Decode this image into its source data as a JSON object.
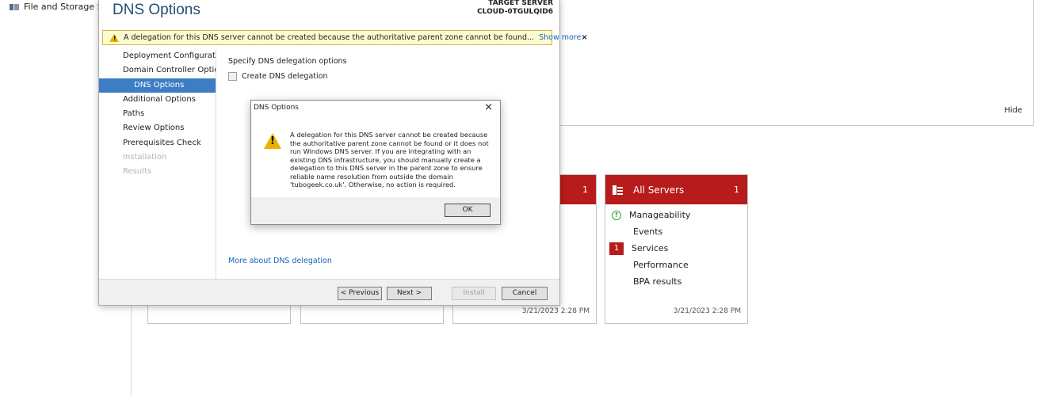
{
  "background": {
    "nav_item": "File and Storage Ser",
    "hide_label": "Hide",
    "tile_badge_count": "1",
    "tile3_timestamp": "3/21/2023 2:28 PM",
    "all_servers": {
      "title": "All Servers",
      "count": "1",
      "rows": [
        {
          "label": "Manageability",
          "badge": "",
          "icon": "up-arrow-circle-icon"
        },
        {
          "label": "Events",
          "badge": ""
        },
        {
          "label": "Services",
          "badge": "1"
        },
        {
          "label": "Performance",
          "badge": ""
        },
        {
          "label": "BPA results",
          "badge": ""
        }
      ],
      "timestamp": "3/21/2023 2:28 PM"
    }
  },
  "wizard": {
    "title": "DNS Options",
    "target_label": "TARGET SERVER",
    "target_name": "CLOUD-0TGULQID6",
    "banner_text": "A delegation for this DNS server cannot be created because the authoritative parent zone cannot be found...",
    "show_more": "Show more",
    "banner_close": "×",
    "nav": [
      "Deployment Configuration",
      "Domain Controller Options",
      "DNS Options",
      "Additional Options",
      "Paths",
      "Review Options",
      "Prerequisites Check",
      "Installation",
      "Results"
    ],
    "spec_label": "Specify DNS delegation options",
    "create_label": "Create DNS delegation",
    "more_link": "More about DNS delegation",
    "buttons": {
      "previous": "< Previous",
      "next": "Next >",
      "install": "Install",
      "cancel": "Cancel"
    }
  },
  "msgbox": {
    "title": "DNS Options",
    "close": "×",
    "lines": [
      "A delegation for this DNS server cannot be created because",
      "the authoritative parent zone cannot be found or it does not",
      "run Windows DNS server. If you are integrating with an",
      "existing DNS infrastructure, you should manually create a",
      "delegation to this DNS server in the parent zone to ensure",
      "reliable name resolution from outside the domain",
      "'tubogeek.co.uk'. Otherwise, no action is required."
    ],
    "ok": "OK"
  },
  "colors": {
    "tile_header": "#b81b1c",
    "nav_active": "#3c7dc4",
    "title_blue": "#1f4e79",
    "link_blue": "#1a64b5",
    "warning_yellow": "#e8b400"
  }
}
